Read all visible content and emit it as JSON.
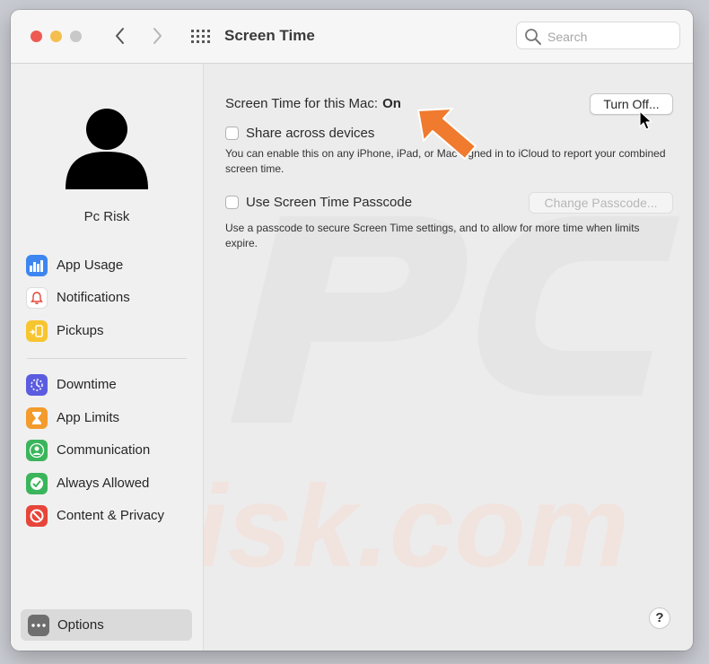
{
  "window": {
    "title": "Screen Time",
    "search_placeholder": "Search"
  },
  "sidebar": {
    "user_name": "Pc Risk",
    "group1": [
      {
        "label": "App Usage",
        "icon": "bar-chart-icon",
        "color": "#3d86f0"
      },
      {
        "label": "Notifications",
        "icon": "bell-icon",
        "color": "#ffffff"
      },
      {
        "label": "Pickups",
        "icon": "phone-pickup-icon",
        "color": "#f7c530"
      }
    ],
    "group2": [
      {
        "label": "Downtime",
        "icon": "downtime-icon",
        "color": "#5b5ce0"
      },
      {
        "label": "App Limits",
        "icon": "hourglass-icon",
        "color": "#f39b2c"
      },
      {
        "label": "Communication",
        "icon": "person-circle-icon",
        "color": "#3bb55c"
      },
      {
        "label": "Always Allowed",
        "icon": "checkmark-icon",
        "color": "#3bb55c"
      },
      {
        "label": "Content & Privacy",
        "icon": "no-entry-icon",
        "color": "#e6453a"
      }
    ],
    "options": {
      "label": "Options",
      "icon": "more-icon",
      "color": "#6e6e6e"
    }
  },
  "main": {
    "status_label": "Screen Time for this Mac:",
    "status_value": "On",
    "turn_off_button": "Turn Off...",
    "share_label": "Share across devices",
    "share_description": "You can enable this on any iPhone, iPad, or Mac signed in to iCloud to report your combined screen time.",
    "passcode_label": "Use Screen Time Passcode",
    "change_passcode_button": "Change Passcode...",
    "passcode_description": "Use a passcode to secure Screen Time settings, and to allow for more time when limits expire.",
    "help_button": "?"
  }
}
